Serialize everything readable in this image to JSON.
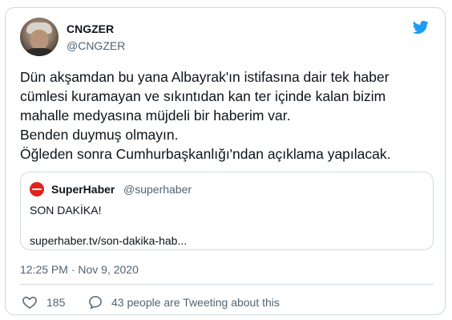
{
  "tweet": {
    "author_name": "CNGZER",
    "author_handle": "@CNGZER",
    "text": "Dün akşamdan bu yana Albayrak'ın istifasına dair tek haber\ncümlesi kuramayan ve sıkıntıdan kan ter içinde kalan bizim\nmahalle medyasına müjdeli bir haberim var.\nBenden duymuş olmayın.\nÖğleden sonra Cumhurbaşkanlığı'ndan açıklama yapılacak.",
    "timestamp": "12:25 PM · Nov 9, 2020",
    "like_count": "185",
    "people_tweeting": "43 people are Tweeting about this"
  },
  "quoted_tweet": {
    "author_name": "SuperHaber",
    "author_handle": "@superhaber",
    "text": "SON DAKİKA!",
    "link": "superhaber.tv/son-dakika-hab..."
  },
  "icons": {
    "twitter": "twitter-bird-icon",
    "like": "heart-icon",
    "people": "people-tweeting-icon"
  },
  "colors": {
    "twitter_blue": "#1d9bf0",
    "text_primary": "#0f1419",
    "text_secondary": "#536471",
    "border": "#cfd9de",
    "superhaber_red": "#e0241b"
  }
}
